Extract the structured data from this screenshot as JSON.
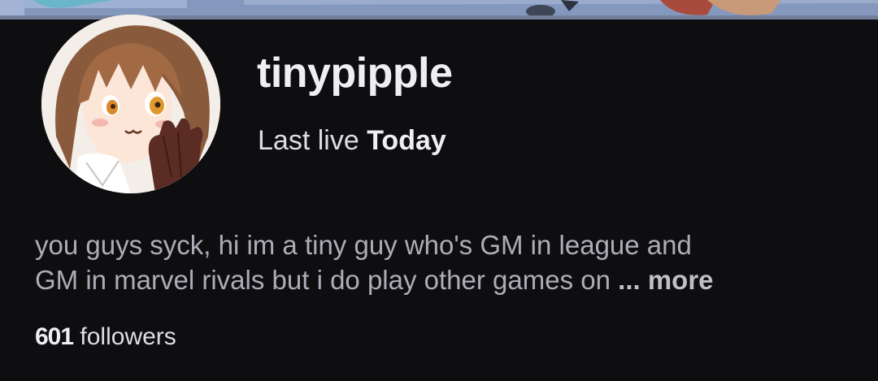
{
  "profile": {
    "username": "tinypipple",
    "last_live_label": "Last live",
    "last_live_value": "Today"
  },
  "bio": {
    "line1": "you guys syck, hi im a tiny guy who's GM in league and",
    "line2": "GM in marvel rivals but i do play other games on",
    "ellipsis": "...",
    "more_label": "more"
  },
  "stats": {
    "followers_count": "601",
    "followers_label": "followers"
  },
  "colors": {
    "background": "#0e0e10",
    "text_primary": "#efeff1",
    "text_secondary": "#adadb8"
  }
}
